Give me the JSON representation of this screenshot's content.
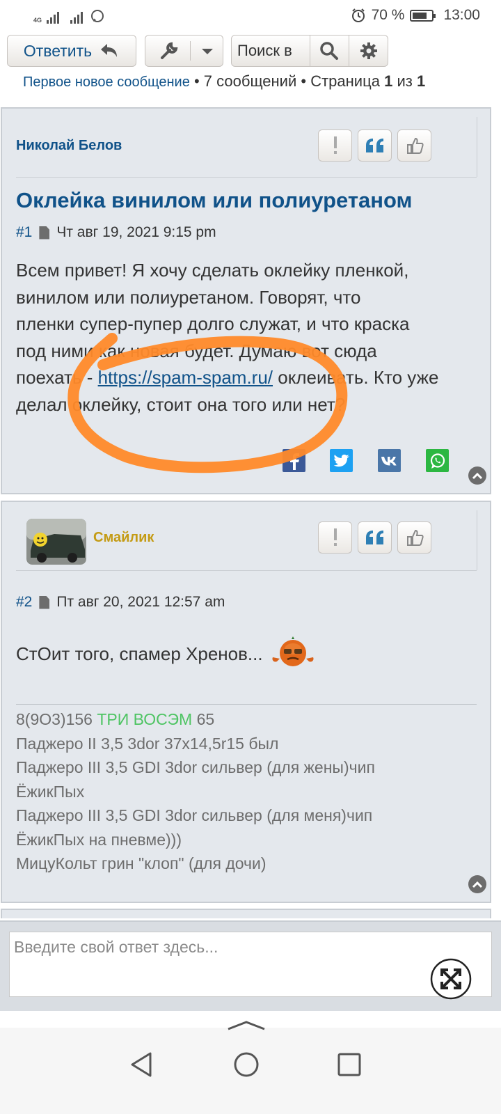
{
  "status": {
    "network": "4G",
    "battery": "70 %",
    "time": "13:00"
  },
  "toolbar": {
    "reply_label": "Ответить",
    "search_placeholder": "Поиск в"
  },
  "pagination": {
    "first_unread": "Первое новое сообщение",
    "bullet1": "•",
    "count": "7 сообщений",
    "bullet2": "•",
    "page_word": "Страница",
    "page": "1",
    "of_word": "из",
    "total": "1"
  },
  "posts": [
    {
      "author": "Николай Белов",
      "title": "Оклейка винилом или полиуретаном",
      "number": "#1",
      "date": "Чт авг 19, 2021 9:15 pm",
      "body_lines": [
        "Всем привет! Я хочу сделать оклейку пленкой,",
        "винилом или полиуретаном. Говорят, что",
        "пленки супер-пупер долго служат, и что краска",
        "под ними как новая будет. Думаю вот сюда"
      ],
      "body_line5_before": "поехать - ",
      "link": "https://spam-spam.ru/",
      "body_line5_after": " оклеивать. Кто уже",
      "body_line6": "делал оклейку, стоит она того или нет?"
    },
    {
      "author": "Смайлик",
      "number": "#2",
      "date": "Пт авг 20, 2021 12:57 am",
      "body": "СтОит того, спамер Хренов...",
      "signature": {
        "phone_before": "8(9O3)156 ",
        "phone_highlight": "ТРИ ВОСЭМ",
        "phone_after": " 65",
        "lines": [
          "Паджеро II 3,5 3dor 37x14,5r15 был",
          "Паджеро III 3,5 GDI 3dor сильвер (для жены)чип",
          "ЁжикПых",
          "Паджеро III 3,5 GDI 3dor сильвер (для меня)чип",
          "ЁжикПых на пневме)))",
          "МицуКольт грин \"клоп\" (для дочи)"
        ]
      }
    }
  ],
  "reply_placeholder": "Введите свой ответ здесь...",
  "colors": {
    "link": "#105289",
    "post_bg": "#e4e8ed",
    "author1": "#105289",
    "author2": "#c49b14",
    "annotation": "#ff8a2a",
    "sig_green": "#4ec463"
  },
  "icons": [
    "reply-arrow-icon",
    "wrench-icon",
    "caret-down-icon",
    "search-icon",
    "gear-icon",
    "report-icon",
    "quote-icon",
    "thumbs-up-icon",
    "facebook-icon",
    "twitter-icon",
    "vk-icon",
    "whatsapp-icon",
    "back-to-top-icon",
    "expand-icon",
    "nav-back-icon",
    "nav-home-icon",
    "nav-recents-icon"
  ]
}
